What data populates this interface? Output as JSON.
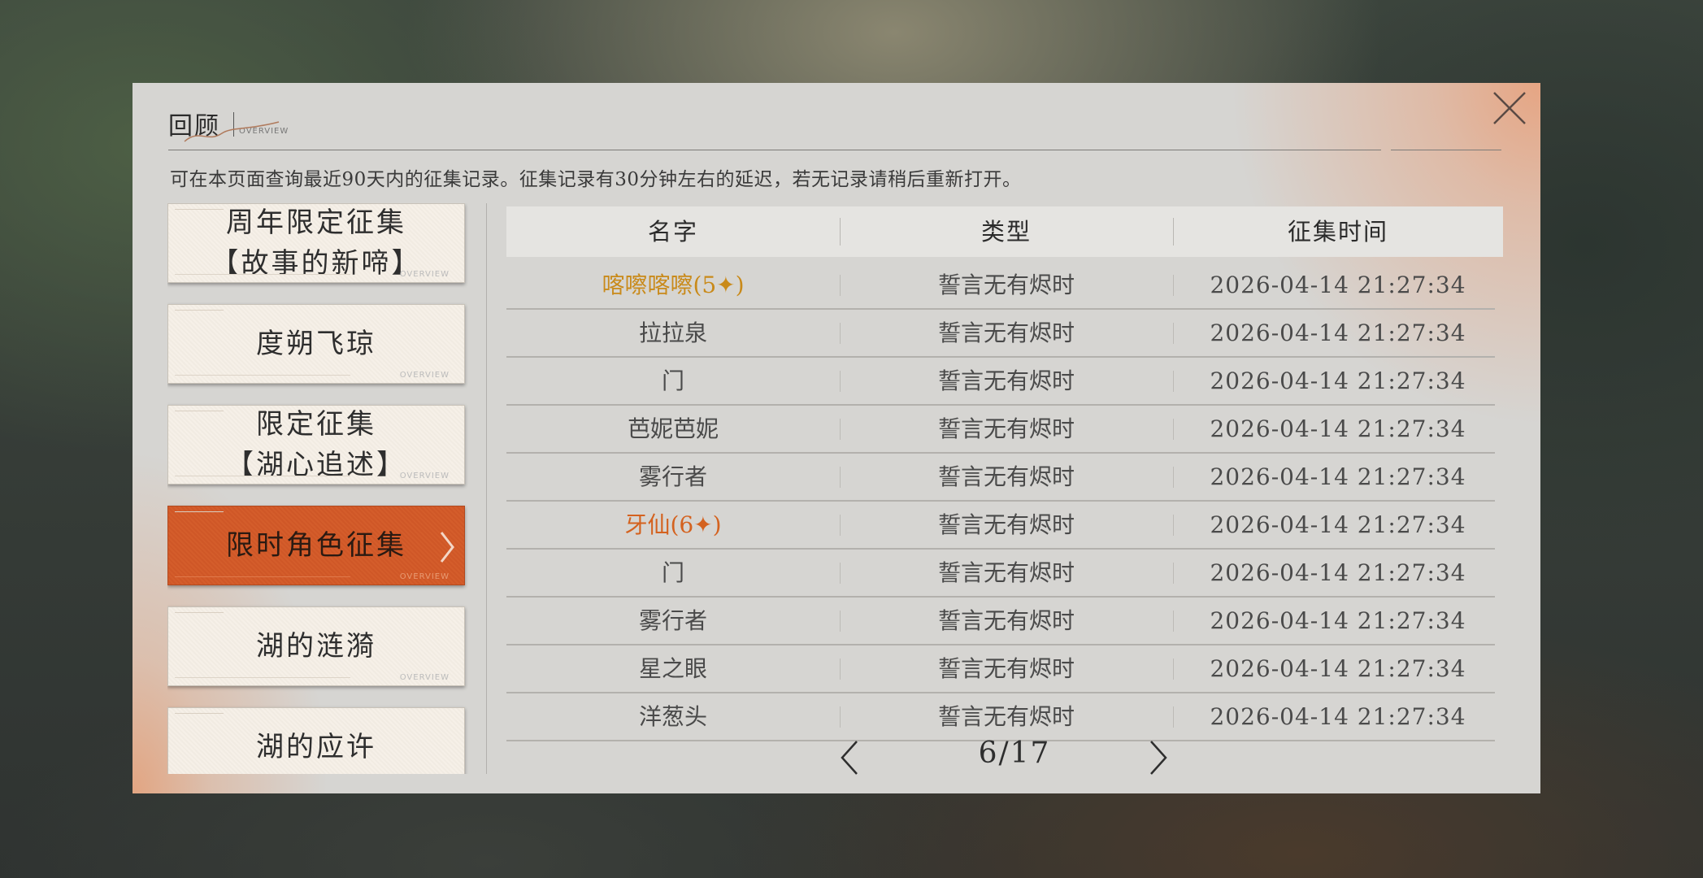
{
  "header": {
    "title": "回顾",
    "subtitle": "OVERVIEW",
    "notice": "可在本页面查询最近90天内的征集记录。征集记录有30分钟左右的延迟，若无记录请稍后重新打开。"
  },
  "sidebar": {
    "items": [
      {
        "label": "周年限定征集\n【故事的新啼】",
        "active": false
      },
      {
        "label": "度朔飞琼",
        "active": false
      },
      {
        "label": "限定征集\n【湖心追述】",
        "active": false
      },
      {
        "label": "限时角色征集",
        "active": true
      },
      {
        "label": "湖的涟漪",
        "active": false
      },
      {
        "label": "湖的应许",
        "active": false
      }
    ],
    "overview_text": "OVERVIEW"
  },
  "table": {
    "headers": [
      "名字",
      "类型",
      "征集时间"
    ],
    "rows": [
      {
        "name": "喀嚓喀嚓(5✦)",
        "type": "誓言无有烬时",
        "time": "2026-04-14 21:27:34",
        "color": "#c98a1a"
      },
      {
        "name": "拉拉泉",
        "type": "誓言无有烬时",
        "time": "2026-04-14 21:27:34",
        "color": "#4a4a4a"
      },
      {
        "name": "门",
        "type": "誓言无有烬时",
        "time": "2026-04-14 21:27:34",
        "color": "#4a4a4a"
      },
      {
        "name": "芭妮芭妮",
        "type": "誓言无有烬时",
        "time": "2026-04-14 21:27:34",
        "color": "#4a4a4a"
      },
      {
        "name": "雾行者",
        "type": "誓言无有烬时",
        "time": "2026-04-14 21:27:34",
        "color": "#4a4a4a"
      },
      {
        "name": "牙仙(6✦)",
        "type": "誓言无有烬时",
        "time": "2026-04-14 21:27:34",
        "color": "#d4621f"
      },
      {
        "name": "门",
        "type": "誓言无有烬时",
        "time": "2026-04-14 21:27:34",
        "color": "#4a4a4a"
      },
      {
        "name": "雾行者",
        "type": "誓言无有烬时",
        "time": "2026-04-14 21:27:34",
        "color": "#4a4a4a"
      },
      {
        "name": "星之眼",
        "type": "誓言无有烬时",
        "time": "2026-04-14 21:27:34",
        "color": "#4a4a4a"
      },
      {
        "name": "洋葱头",
        "type": "誓言无有烬时",
        "time": "2026-04-14 21:27:34",
        "color": "#4a4a4a"
      }
    ]
  },
  "pager": {
    "current": 6,
    "total": 17,
    "display": "6/17"
  },
  "icons": {
    "close": "close-icon",
    "prev": "chevron-left-icon",
    "next": "chevron-right-icon",
    "active_arrow": "chevron-right-icon"
  }
}
